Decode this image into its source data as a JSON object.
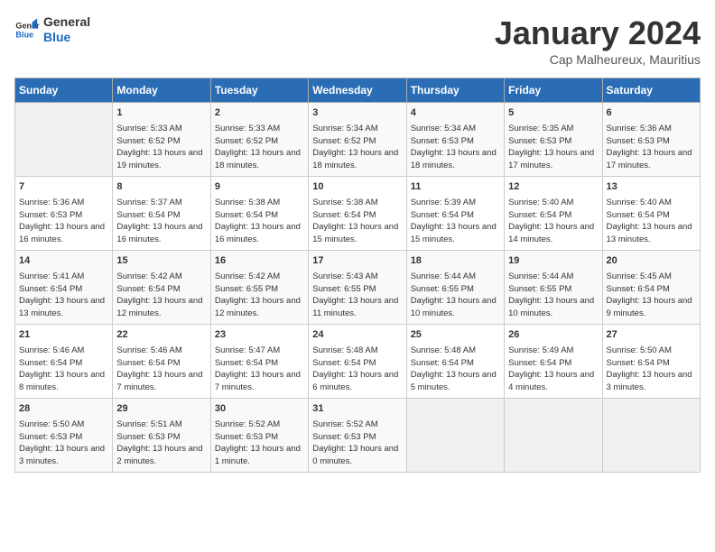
{
  "logo": {
    "line1": "General",
    "line2": "Blue"
  },
  "title": "January 2024",
  "subtitle": "Cap Malheureux, Mauritius",
  "days_of_week": [
    "Sunday",
    "Monday",
    "Tuesday",
    "Wednesday",
    "Thursday",
    "Friday",
    "Saturday"
  ],
  "weeks": [
    [
      {
        "day": "",
        "sunrise": "",
        "sunset": "",
        "daylight": ""
      },
      {
        "day": "1",
        "sunrise": "Sunrise: 5:33 AM",
        "sunset": "Sunset: 6:52 PM",
        "daylight": "Daylight: 13 hours and 19 minutes."
      },
      {
        "day": "2",
        "sunrise": "Sunrise: 5:33 AM",
        "sunset": "Sunset: 6:52 PM",
        "daylight": "Daylight: 13 hours and 18 minutes."
      },
      {
        "day": "3",
        "sunrise": "Sunrise: 5:34 AM",
        "sunset": "Sunset: 6:52 PM",
        "daylight": "Daylight: 13 hours and 18 minutes."
      },
      {
        "day": "4",
        "sunrise": "Sunrise: 5:34 AM",
        "sunset": "Sunset: 6:53 PM",
        "daylight": "Daylight: 13 hours and 18 minutes."
      },
      {
        "day": "5",
        "sunrise": "Sunrise: 5:35 AM",
        "sunset": "Sunset: 6:53 PM",
        "daylight": "Daylight: 13 hours and 17 minutes."
      },
      {
        "day": "6",
        "sunrise": "Sunrise: 5:36 AM",
        "sunset": "Sunset: 6:53 PM",
        "daylight": "Daylight: 13 hours and 17 minutes."
      }
    ],
    [
      {
        "day": "7",
        "sunrise": "Sunrise: 5:36 AM",
        "sunset": "Sunset: 6:53 PM",
        "daylight": "Daylight: 13 hours and 16 minutes."
      },
      {
        "day": "8",
        "sunrise": "Sunrise: 5:37 AM",
        "sunset": "Sunset: 6:54 PM",
        "daylight": "Daylight: 13 hours and 16 minutes."
      },
      {
        "day": "9",
        "sunrise": "Sunrise: 5:38 AM",
        "sunset": "Sunset: 6:54 PM",
        "daylight": "Daylight: 13 hours and 16 minutes."
      },
      {
        "day": "10",
        "sunrise": "Sunrise: 5:38 AM",
        "sunset": "Sunset: 6:54 PM",
        "daylight": "Daylight: 13 hours and 15 minutes."
      },
      {
        "day": "11",
        "sunrise": "Sunrise: 5:39 AM",
        "sunset": "Sunset: 6:54 PM",
        "daylight": "Daylight: 13 hours and 15 minutes."
      },
      {
        "day": "12",
        "sunrise": "Sunrise: 5:40 AM",
        "sunset": "Sunset: 6:54 PM",
        "daylight": "Daylight: 13 hours and 14 minutes."
      },
      {
        "day": "13",
        "sunrise": "Sunrise: 5:40 AM",
        "sunset": "Sunset: 6:54 PM",
        "daylight": "Daylight: 13 hours and 13 minutes."
      }
    ],
    [
      {
        "day": "14",
        "sunrise": "Sunrise: 5:41 AM",
        "sunset": "Sunset: 6:54 PM",
        "daylight": "Daylight: 13 hours and 13 minutes."
      },
      {
        "day": "15",
        "sunrise": "Sunrise: 5:42 AM",
        "sunset": "Sunset: 6:54 PM",
        "daylight": "Daylight: 13 hours and 12 minutes."
      },
      {
        "day": "16",
        "sunrise": "Sunrise: 5:42 AM",
        "sunset": "Sunset: 6:55 PM",
        "daylight": "Daylight: 13 hours and 12 minutes."
      },
      {
        "day": "17",
        "sunrise": "Sunrise: 5:43 AM",
        "sunset": "Sunset: 6:55 PM",
        "daylight": "Daylight: 13 hours and 11 minutes."
      },
      {
        "day": "18",
        "sunrise": "Sunrise: 5:44 AM",
        "sunset": "Sunset: 6:55 PM",
        "daylight": "Daylight: 13 hours and 10 minutes."
      },
      {
        "day": "19",
        "sunrise": "Sunrise: 5:44 AM",
        "sunset": "Sunset: 6:55 PM",
        "daylight": "Daylight: 13 hours and 10 minutes."
      },
      {
        "day": "20",
        "sunrise": "Sunrise: 5:45 AM",
        "sunset": "Sunset: 6:54 PM",
        "daylight": "Daylight: 13 hours and 9 minutes."
      }
    ],
    [
      {
        "day": "21",
        "sunrise": "Sunrise: 5:46 AM",
        "sunset": "Sunset: 6:54 PM",
        "daylight": "Daylight: 13 hours and 8 minutes."
      },
      {
        "day": "22",
        "sunrise": "Sunrise: 5:46 AM",
        "sunset": "Sunset: 6:54 PM",
        "daylight": "Daylight: 13 hours and 7 minutes."
      },
      {
        "day": "23",
        "sunrise": "Sunrise: 5:47 AM",
        "sunset": "Sunset: 6:54 PM",
        "daylight": "Daylight: 13 hours and 7 minutes."
      },
      {
        "day": "24",
        "sunrise": "Sunrise: 5:48 AM",
        "sunset": "Sunset: 6:54 PM",
        "daylight": "Daylight: 13 hours and 6 minutes."
      },
      {
        "day": "25",
        "sunrise": "Sunrise: 5:48 AM",
        "sunset": "Sunset: 6:54 PM",
        "daylight": "Daylight: 13 hours and 5 minutes."
      },
      {
        "day": "26",
        "sunrise": "Sunrise: 5:49 AM",
        "sunset": "Sunset: 6:54 PM",
        "daylight": "Daylight: 13 hours and 4 minutes."
      },
      {
        "day": "27",
        "sunrise": "Sunrise: 5:50 AM",
        "sunset": "Sunset: 6:54 PM",
        "daylight": "Daylight: 13 hours and 3 minutes."
      }
    ],
    [
      {
        "day": "28",
        "sunrise": "Sunrise: 5:50 AM",
        "sunset": "Sunset: 6:53 PM",
        "daylight": "Daylight: 13 hours and 3 minutes."
      },
      {
        "day": "29",
        "sunrise": "Sunrise: 5:51 AM",
        "sunset": "Sunset: 6:53 PM",
        "daylight": "Daylight: 13 hours and 2 minutes."
      },
      {
        "day": "30",
        "sunrise": "Sunrise: 5:52 AM",
        "sunset": "Sunset: 6:53 PM",
        "daylight": "Daylight: 13 hours and 1 minute."
      },
      {
        "day": "31",
        "sunrise": "Sunrise: 5:52 AM",
        "sunset": "Sunset: 6:53 PM",
        "daylight": "Daylight: 13 hours and 0 minutes."
      },
      {
        "day": "",
        "sunrise": "",
        "sunset": "",
        "daylight": ""
      },
      {
        "day": "",
        "sunrise": "",
        "sunset": "",
        "daylight": ""
      },
      {
        "day": "",
        "sunrise": "",
        "sunset": "",
        "daylight": ""
      }
    ]
  ]
}
